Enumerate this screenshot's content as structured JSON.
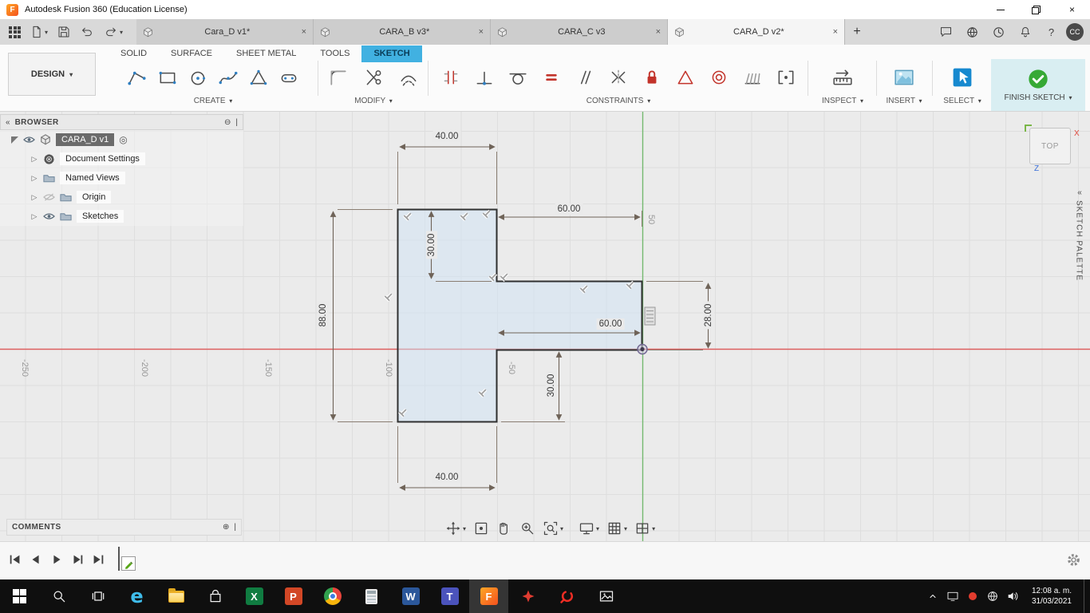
{
  "icons": {
    "caret_down": "▾",
    "close": "×",
    "plus_tab": "+",
    "collapse": "«",
    "circle_minus": "⊖",
    "circle_plus": "⊕",
    "grip": "|",
    "expander": "▷",
    "target": "◎",
    "help": "?",
    "edge_letter": "e",
    "excel_letter": "X",
    "ppt_letter": "P",
    "word_letter": "W",
    "teams_letter": "T",
    "fusion_letter": "F"
  },
  "window": {
    "title": "Autodesk Fusion 360 (Education License)"
  },
  "doc_tabs": {
    "tabs": [
      {
        "label": "Cara_D v1*"
      },
      {
        "label": "CARA_B v3*"
      },
      {
        "label": "CARA_C v3"
      },
      {
        "label": "CARA_D v2*"
      }
    ],
    "avatar": "CC"
  },
  "ribbon": {
    "workspace": "DESIGN",
    "env_tabs": [
      {
        "label": "SOLID"
      },
      {
        "label": "SURFACE"
      },
      {
        "label": "SHEET METAL"
      },
      {
        "label": "TOOLS"
      },
      {
        "label": "SKETCH"
      }
    ],
    "groups": {
      "create": "CREATE",
      "modify": "MODIFY",
      "constraints": "CONSTRAINTS",
      "inspect": "INSPECT",
      "insert": "INSERT",
      "select": "SELECT",
      "finish": "FINISH SKETCH"
    }
  },
  "browser": {
    "header": "BROWSER",
    "root": "CARA_D v1",
    "items": [
      {
        "label": "Document Settings"
      },
      {
        "label": "Named Views"
      },
      {
        "label": "Origin"
      },
      {
        "label": "Sketches"
      }
    ]
  },
  "canvas": {
    "dims": {
      "top_width": "40.00",
      "top_right_width": "60.00",
      "upper_height": "30.00",
      "left_height": "88.00",
      "arm_width": "60.00",
      "arm_height": "28.00",
      "lower_right_height": "30.00",
      "bottom_width": "40.00"
    },
    "axis_x": [
      {
        "v": "-250"
      },
      {
        "v": "-200"
      },
      {
        "v": "-150"
      },
      {
        "v": "-100"
      },
      {
        "v": "-50"
      }
    ],
    "axis_y": "50",
    "viewcube": {
      "face": "TOP",
      "x": "X",
      "z": "Z"
    },
    "palette": "SKETCH PALETTE"
  },
  "comments": {
    "label": "COMMENTS"
  },
  "tray": {
    "time": "12:08 a. m.",
    "date": "31/03/2021"
  }
}
